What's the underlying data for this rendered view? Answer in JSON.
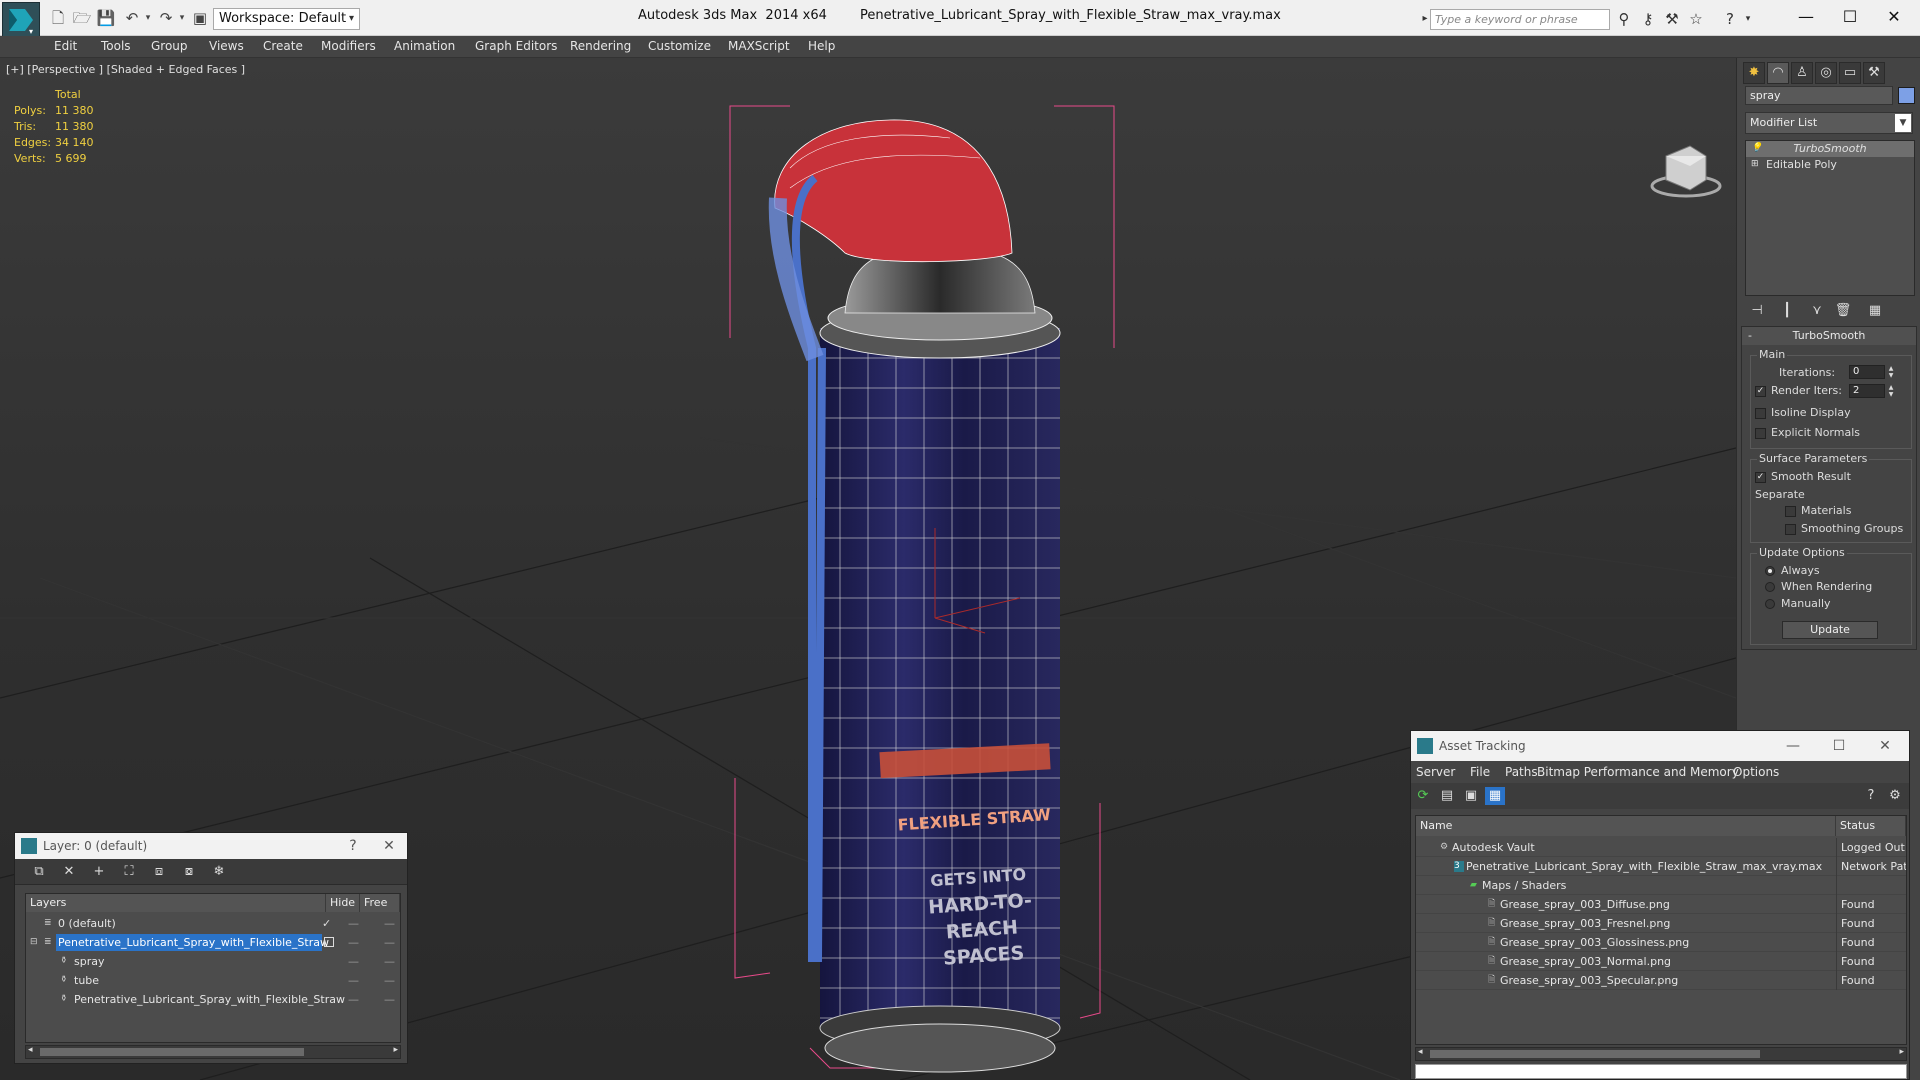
{
  "titlebar": {
    "workspace": "Workspace: Default",
    "app_name": "Autodesk 3ds Max  2014 x64",
    "file_name": "Penetrative_Lubricant_Spray_with_Flexible_Straw_max_vray.max",
    "search_placeholder": "Type a keyword or phrase"
  },
  "menu": [
    "Edit",
    "Tools",
    "Group",
    "Views",
    "Create",
    "Modifiers",
    "Animation",
    "Graph Editors",
    "Rendering",
    "Customize",
    "MAXScript",
    "Help"
  ],
  "viewport": {
    "label": "[+] [Perspective ] [Shaded + Edged Faces ]",
    "stats_header": "Total",
    "stats": [
      {
        "label": "Polys:",
        "value": "11 380"
      },
      {
        "label": "Tris:",
        "value": "11 380"
      },
      {
        "label": "Edges:",
        "value": "34 140"
      },
      {
        "label": "Verts:",
        "value": "5 699"
      }
    ],
    "can_text": {
      "band": "FLEXIBLE STRAW",
      "line1": "GETS INTO",
      "line2": "HARD-TO-REACH",
      "line3": "SPACES"
    },
    "colors": {
      "can_blue": "#28285e",
      "cap_red": "#c8323a",
      "straw_blue": "#4a70c8",
      "bbox_pink": "#e84a8a"
    }
  },
  "command_panel": {
    "object_name": "spray",
    "object_color": "#7da0e6",
    "modifier_list": "Modifier List",
    "stack": [
      "TurboSmooth",
      "Editable Poly"
    ],
    "turbosmooth": {
      "title": "TurboSmooth",
      "main_group": "Main",
      "iterations_label": "Iterations:",
      "iterations_value": "0",
      "render_iters_label": "Render Iters:",
      "render_iters_value": "2",
      "isoline": "Isoline Display",
      "explicit_normals": "Explicit Normals",
      "surface_group": "Surface Parameters",
      "smooth_result": "Smooth Result",
      "separate": "Separate",
      "materials": "Materials",
      "smoothing_groups": "Smoothing Groups",
      "update_group": "Update Options",
      "always": "Always",
      "when_rendering": "When Rendering",
      "manually": "Manually",
      "update_btn": "Update"
    }
  },
  "layer_explorer": {
    "title": "Layer: 0 (default)",
    "help": "?",
    "col_layers": "Layers",
    "col_hide": "Hide",
    "col_freeze": "Free",
    "rows": [
      {
        "name": "0 (default)",
        "indent": 0
      },
      {
        "name": "Penetrative_Lubricant_Spray_with_Flexible_Straw",
        "indent": 0
      },
      {
        "name": "spray",
        "indent": 1
      },
      {
        "name": "tube",
        "indent": 1
      },
      {
        "name": "Penetrative_Lubricant_Spray_with_Flexible_Straw",
        "indent": 1
      }
    ]
  },
  "asset_tracking": {
    "title": "Asset Tracking",
    "menu": [
      "Server",
      "File",
      "Paths",
      "Bitmap Performance and Memory",
      "Options"
    ],
    "col_name": "Name",
    "col_status": "Status",
    "rows": [
      {
        "name": "Autodesk Vault",
        "status": "Logged Out",
        "indent": 0
      },
      {
        "name": "Penetrative_Lubricant_Spray_with_Flexible_Straw_max_vray.max",
        "status": "Network Pat",
        "indent": 1
      },
      {
        "name": "Maps / Shaders",
        "status": "",
        "indent": 2
      },
      {
        "name": "Grease_spray_003_Diffuse.png",
        "status": "Found",
        "indent": 3
      },
      {
        "name": "Grease_spray_003_Fresnel.png",
        "status": "Found",
        "indent": 3
      },
      {
        "name": "Grease_spray_003_Glossiness.png",
        "status": "Found",
        "indent": 3
      },
      {
        "name": "Grease_spray_003_Normal.png",
        "status": "Found",
        "indent": 3
      },
      {
        "name": "Grease_spray_003_Specular.png",
        "status": "Found",
        "indent": 3
      }
    ]
  }
}
